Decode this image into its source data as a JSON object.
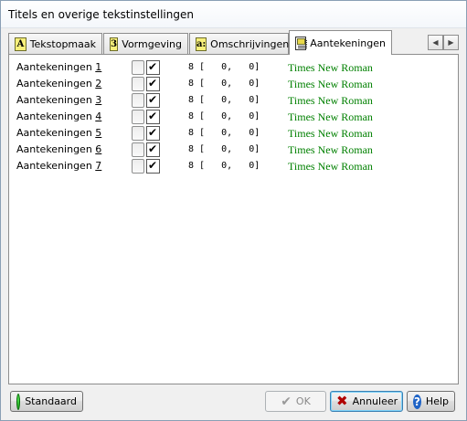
{
  "window": {
    "title": "Titels en overige tekstinstellingen"
  },
  "tabs": [
    {
      "label": "Tekstopmaak",
      "icon": "A"
    },
    {
      "label": "Vormgeving",
      "icon": "3"
    },
    {
      "label": "Omschrijvingen",
      "icon": "a:"
    },
    {
      "label": "Aantekeningen",
      "icon": "notes-icon"
    }
  ],
  "rows": [
    {
      "label": "Aantekeningen ",
      "num": "1",
      "size": "8 [   0,   0]",
      "font": "Times New Roman"
    },
    {
      "label": "Aantekeningen ",
      "num": "2",
      "size": "8 [   0,   0]",
      "font": "Times New Roman"
    },
    {
      "label": "Aantekeningen ",
      "num": "3",
      "size": "8 [   0,   0]",
      "font": "Times New Roman"
    },
    {
      "label": "Aantekeningen ",
      "num": "4",
      "size": "8 [   0,   0]",
      "font": "Times New Roman"
    },
    {
      "label": "Aantekeningen ",
      "num": "5",
      "size": "8 [   0,   0]",
      "font": "Times New Roman"
    },
    {
      "label": "Aantekeningen ",
      "num": "6",
      "size": "8 [   0,   0]",
      "font": "Times New Roman"
    },
    {
      "label": "Aantekeningen ",
      "num": "7",
      "size": "8 [   0,   0]",
      "font": "Times New Roman"
    }
  ],
  "buttons": {
    "standaard": "Standaard",
    "ok": "OK",
    "annuleer": "Annuleer",
    "help": "Help"
  },
  "colors": {
    "font_preview": "#008000",
    "title_bg": "#ffffff"
  }
}
